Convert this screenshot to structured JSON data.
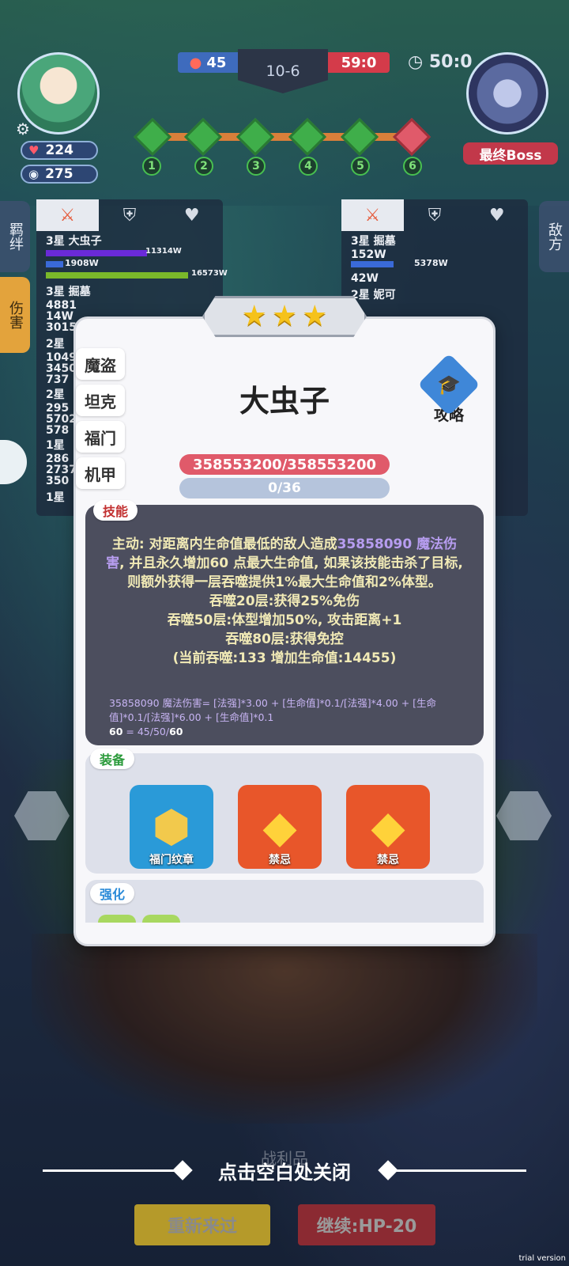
{
  "hud": {
    "player_hp": "224",
    "player_gold": "275",
    "left_score": "45",
    "stage": "10-6",
    "right_score": "59:0",
    "timer": "50:0",
    "boss_label": "最终Boss",
    "nodes": [
      "1",
      "2",
      "3",
      "4",
      "5",
      "6"
    ]
  },
  "side_tabs": {
    "bond": "羁绊",
    "damage": "伤害",
    "enemy": "敌方"
  },
  "left_panel": {
    "rows": [
      {
        "label": "3星 大虫子",
        "v1": "11314W",
        "v2": "1908W",
        "v3": "16573W"
      },
      {
        "label": "3星 掘墓",
        "vals": [
          "4881",
          "14W",
          "3015"
        ]
      },
      {
        "label": "2星",
        "vals": [
          "1049",
          "3450",
          "737"
        ]
      },
      {
        "label": "2星",
        "vals": [
          "295",
          "5702",
          "578"
        ]
      },
      {
        "label": "1星",
        "vals": [
          "286",
          "2737",
          "350"
        ]
      },
      {
        "label": "1星",
        "vals": []
      }
    ]
  },
  "right_panel": {
    "rows": [
      {
        "label": "3星 掘墓",
        "v1": "152W",
        "v2": "5378W"
      },
      {
        "label": "42W"
      },
      {
        "label": "2星 妮可"
      }
    ]
  },
  "modal": {
    "stars": 3,
    "classes": [
      "魔盗",
      "坦克",
      "福门",
      "机甲"
    ],
    "hero_name": "大虫子",
    "guide_label": "攻略",
    "hp_text": "358553200/358553200",
    "exp_text": "0/36",
    "skill_tag": "技能",
    "skill_lines": [
      {
        "pre": "主动: 对距离内生命值最低的敌人造成",
        "hl": "35858090 魔法伤害",
        "post": ", 并且永久增加60 点最大生命值, 如果该技能击杀了目标, 则额外获得一层吞噬提供1%最大生命值和2%体型。"
      },
      {
        "pre": "吞噬20层:获得25%免伤",
        "hl": "",
        "post": ""
      },
      {
        "pre": "吞噬50层:体型增加50%, 攻击距离+1",
        "hl": "",
        "post": ""
      },
      {
        "pre": "吞噬80层:获得免控",
        "hl": "",
        "post": ""
      },
      {
        "pre": "(当前吞噬:133 增加生命值:14455)",
        "hl": "",
        "post": ""
      }
    ],
    "formula_1": "35858090 魔法伤害= [法强]*3.00 + [生命值]*0.1/[法强]*4.00 + [生命值]*0.1/[法强]*6.00 + [生命值]*0.1",
    "formula_2_key": "60",
    "formula_2_val": " = 45/50/",
    "formula_2_end": "60",
    "equip_tag": "装备",
    "equipment": [
      {
        "name": "福门纹章",
        "icon": "emblem-icon"
      },
      {
        "name": "禁忌",
        "icon": "crystal-icon"
      },
      {
        "name": "禁忌",
        "icon": "crystal-icon"
      }
    ],
    "enhance_tag": "强化"
  },
  "bottom": {
    "close_hint": "点击空白处关闭",
    "loot_text": "战利品",
    "retry_button": "重新来过",
    "continue_button": "继续:HP-20"
  },
  "watermark": "trial version"
}
